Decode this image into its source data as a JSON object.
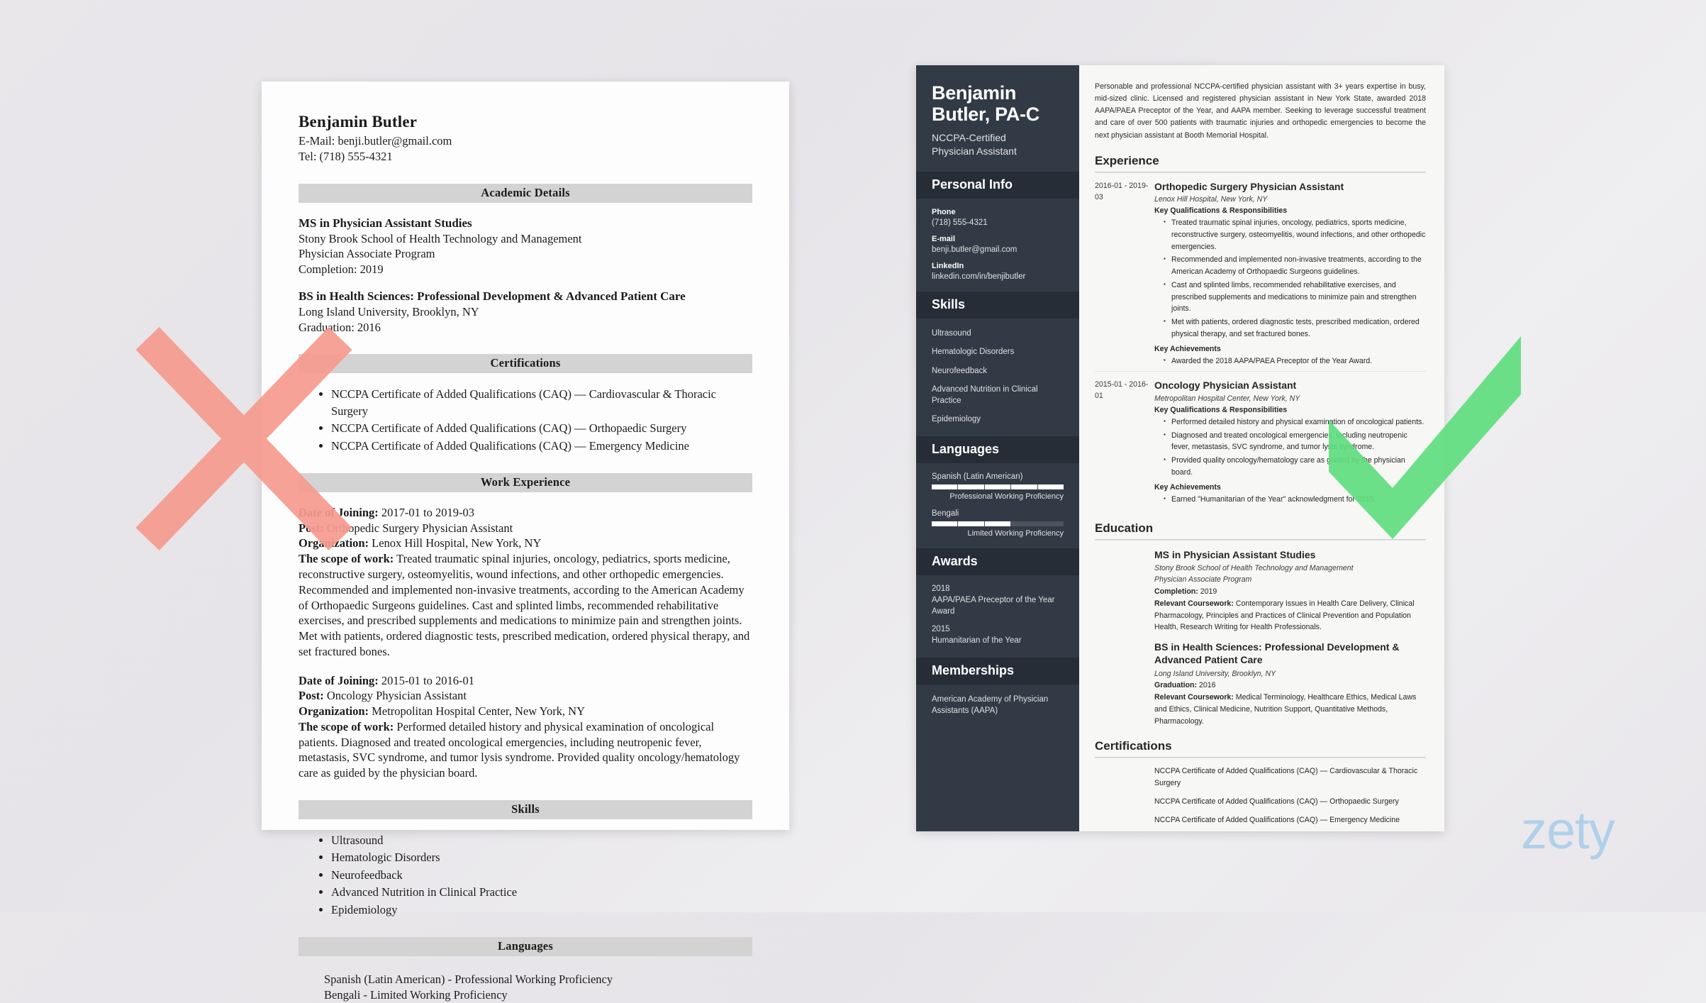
{
  "bad_resume": {
    "name": "Benjamin Butler",
    "email_line": "E-Mail: benji.butler@gmail.com",
    "phone_line": "Tel: (718) 555-4321",
    "sections": {
      "academic": "Academic Details",
      "certifications": "Certifications",
      "work": "Work Experience",
      "skills": "Skills",
      "languages": "Languages"
    },
    "education": [
      {
        "degree": "MS in Physician Assistant Studies",
        "school": "Stony Brook School of Health Technology and Management",
        "program": "Physician Associate Program",
        "date": "Completion: 2019"
      },
      {
        "degree": "BS in Health Sciences: Professional Development & Advanced Patient Care",
        "school": "Long Island University, Brooklyn, NY",
        "program": "",
        "date": "Graduation: 2016"
      }
    ],
    "certifications": [
      "NCCPA Certificate of Added Qualifications (CAQ) — Cardiovascular & Thoracic Surgery",
      "NCCPA Certificate of Added Qualifications (CAQ) — Orthopaedic Surgery",
      "NCCPA Certificate of Added Qualifications (CAQ) — Emergency Medicine"
    ],
    "jobs": [
      {
        "date_label": "Date of Joining:",
        "date_value": " 2017-01 to 2019-03",
        "post_label": "Post:",
        "post_value": " Orthopedic Surgery Physician Assistant",
        "org_label": "Organization:",
        "org_value": " Lenox Hill Hospital, New York, NY",
        "scope_label": "The scope of work:",
        "scope_value": " Treated traumatic spinal injuries, oncology, pediatrics, sports medicine, reconstructive surgery, osteomyelitis, wound infections, and other orthopedic emergencies. Recommended and implemented non-invasive treatments, according to the American Academy of Orthopaedic Surgeons guidelines. Cast and splinted limbs, recommended rehabilitative exercises, and prescribed supplements and medications to minimize pain and strengthen joints. Met with patients, ordered diagnostic tests, prescribed medication, ordered physical therapy, and set fractured bones."
      },
      {
        "date_label": "Date of Joining:",
        "date_value": " 2015-01 to 2016-01",
        "post_label": "Post:",
        "post_value": " Oncology Physician Assistant",
        "org_label": "Organization:",
        "org_value": " Metropolitan Hospital Center, New York, NY",
        "scope_label": "The scope of work:",
        "scope_value": " Performed detailed history and physical examination of oncological patients. Diagnosed and treated oncological emergencies, including neutropenic fever, metastasis, SVC syndrome, and tumor lysis syndrome. Provided quality oncology/hematology care as guided by the physician board."
      }
    ],
    "skills": [
      "Ultrasound",
      "Hematologic Disorders",
      "Neurofeedback",
      "Advanced Nutrition in Clinical Practice",
      "Epidemiology"
    ],
    "languages": [
      "Spanish (Latin American) - Professional Working Proficiency",
      "Bengali - Limited Working Proficiency"
    ]
  },
  "good_resume": {
    "header": {
      "name_line1": "Benjamin",
      "name_line2": "Butler, PA-C",
      "subtitle_line1": "NCCPA-Certified",
      "subtitle_line2": "Physician Assistant"
    },
    "sidebar": {
      "personal_info": {
        "heading": "Personal Info",
        "fields": [
          {
            "label": "Phone",
            "value": "(718) 555-4321"
          },
          {
            "label": "E-mail",
            "value": "benji.butler@gmail.com"
          },
          {
            "label": "LinkedIn",
            "value": "linkedin.com/in/benjibutler"
          }
        ]
      },
      "skills": {
        "heading": "Skills",
        "items": [
          "Ultrasound",
          "Hematologic Disorders",
          "Neurofeedback",
          "Advanced Nutrition in Clinical Practice",
          "Epidemiology"
        ]
      },
      "languages": {
        "heading": "Languages",
        "items": [
          {
            "name": "Spanish (Latin American)",
            "level": "Professional Working Proficiency",
            "percent": 100
          },
          {
            "name": "Bengali",
            "level": "Limited Working Proficiency",
            "percent": 60
          }
        ]
      },
      "awards": {
        "heading": "Awards",
        "items": [
          {
            "year": "2018",
            "name": "AAPA/PAEA Preceptor of the Year Award"
          },
          {
            "year": "2015",
            "name": "Humanitarian of the Year"
          }
        ]
      },
      "memberships": {
        "heading": "Memberships",
        "items": [
          "American Academy of Physician Assistants (AAPA)"
        ]
      }
    },
    "main": {
      "summary": "Personable and professional NCCPA-certified physician assistant with 3+ years expertise in busy, mid-sized clinic. Licensed and registered physician assistant in New York State, awarded 2018 AAPA/PAEA Preceptor of the Year, and AAPA member. Seeking to leverage successful treatment and care of over 500 patients with traumatic injuries and orthopedic emergencies to become the next physician assistant at Booth Memorial Hospital.",
      "experience_heading": "Experience",
      "experience": [
        {
          "date": "2016-01 - 2019-03",
          "title": "Orthopedic Surgery Physician Assistant",
          "org": "Lenox Hill Hospital, New York, NY",
          "qual_heading": "Key Qualifications & Responsibilities",
          "bullets": [
            "Treated traumatic spinal injuries, oncology, pediatrics, sports medicine, reconstructive surgery, osteomyelitis, wound infections, and other orthopedic emergencies.",
            "Recommended and implemented non-invasive treatments, according to the American Academy of Orthopaedic Surgeons guidelines.",
            "Cast and splinted limbs, recommended rehabilitative exercises, and prescribed supplements and medications to minimize pain and strengthen joints.",
            "Met with patients, ordered diagnostic tests, prescribed medication, ordered physical therapy, and set fractured bones."
          ],
          "ach_heading": "Key Achievements",
          "achievements": [
            "Awarded the 2018 AAPA/PAEA Preceptor of the Year Award."
          ]
        },
        {
          "date": "2015-01 - 2016-01",
          "title": "Oncology Physician Assistant",
          "org": "Metropolitan Hospital Center, New York, NY",
          "qual_heading": "Key Qualifications & Responsibilities",
          "bullets": [
            "Performed detailed history and physical examination of oncological patients.",
            "Diagnosed and treated oncological emergencies, including neutropenic fever, metastasis, SVC syndrome, and tumor lysis syndrome.",
            "Provided quality oncology/hematology care as guided by the physician board."
          ],
          "ach_heading": "Key Achievements",
          "achievements": [
            "Earned \"Humanitarian of the Year\" acknowledgment for 2015."
          ]
        }
      ],
      "education_heading": "Education",
      "education": [
        {
          "degree": "MS in Physician Assistant Studies",
          "school": "Stony Brook School of Health Technology and Management",
          "program": "Physician Associate Program",
          "date_label": "Completion:",
          "date_value": " 2019",
          "course_label": "Relevant Coursework:",
          "course_value": " Contemporary Issues in Health Care Delivery, Clinical Pharmacology, Principles and Practices of Clinical Prevention and Population Health, Research Writing for Health Professionals."
        },
        {
          "degree": "BS in Health Sciences: Professional Development & Advanced Patient Care",
          "school": "Long Island University, Brooklyn, NY",
          "program": "",
          "date_label": "Graduation:",
          "date_value": " 2016",
          "course_label": "Relevant Coursework:",
          "course_value": " Medical Terminology, Healthcare Ethics, Medical Laws and Ethics, Clinical Medicine, Nutrition Support, Quantitative Methods, Pharmacology."
        }
      ],
      "certifications_heading": "Certifications",
      "certifications": [
        "NCCPA Certificate of Added Qualifications (CAQ) — Cardiovascular & Thoracic Surgery",
        "NCCPA Certificate of Added Qualifications (CAQ) — Orthopaedic Surgery",
        "NCCPA Certificate of Added Qualifications (CAQ) — Emergency Medicine"
      ]
    }
  },
  "overlays": {
    "reject_mark": "x-mark",
    "approve_mark": "check-mark",
    "reject_color": "#f79b8e",
    "approve_color": "#5fdd7e"
  },
  "watermark": {
    "text": "zety",
    "color": "#a9cdea"
  }
}
